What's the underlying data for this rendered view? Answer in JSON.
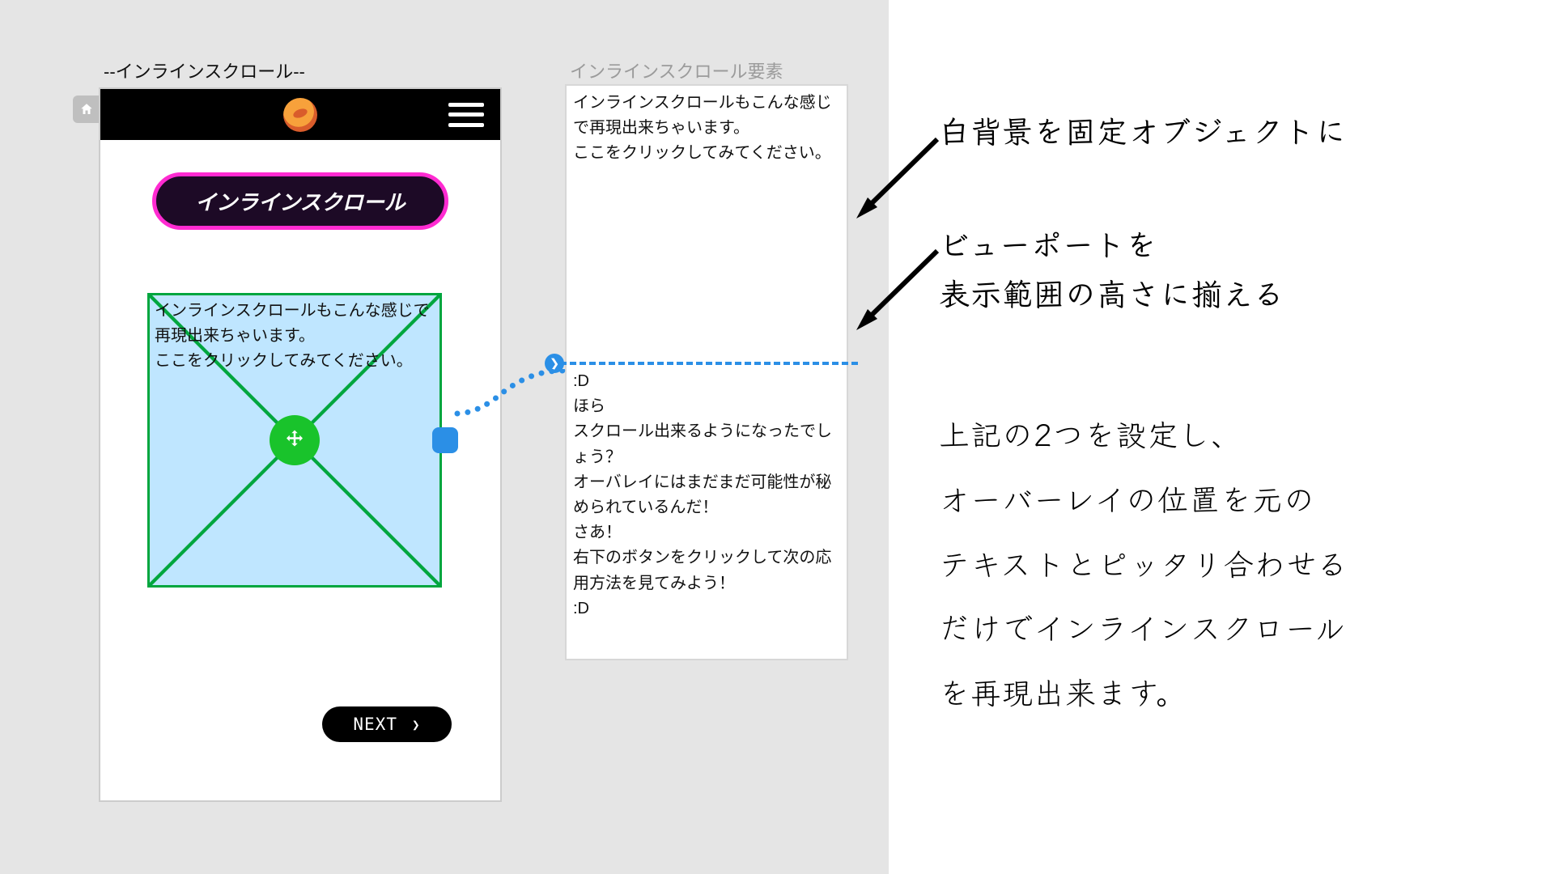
{
  "phone": {
    "label": "--インラインスクロール--",
    "pill": "インラインスクロール",
    "scroll_text": "インラインスクロールもこんな感じで再現出来ちゃいます。\nここをクリックしてみてください。",
    "next": "NEXT"
  },
  "element": {
    "label": "インラインスクロール要素",
    "top_text": "インラインスクロールもこんな感じで再現出来ちゃいます。\nここをクリックしてみてください。",
    "bottom_text": ":D\nほら\nスクロール出来るようになったでしょう？\nオーバレイにはまだまだ可能性が秘められているんだ！\nさあ！\n右下のボタンをクリックして次の応用方法を見てみよう！\n:D"
  },
  "notes": {
    "n1": "白背景を固定オブジェクトに",
    "n2": "ビューポートを\n表示範囲の高さに揃える",
    "para": "上記の2つを設定し、\nオーバーレイの位置を元の\nテキストとピッタリ合わせる\nだけでインラインスクロール\nを再現出来ます。"
  }
}
